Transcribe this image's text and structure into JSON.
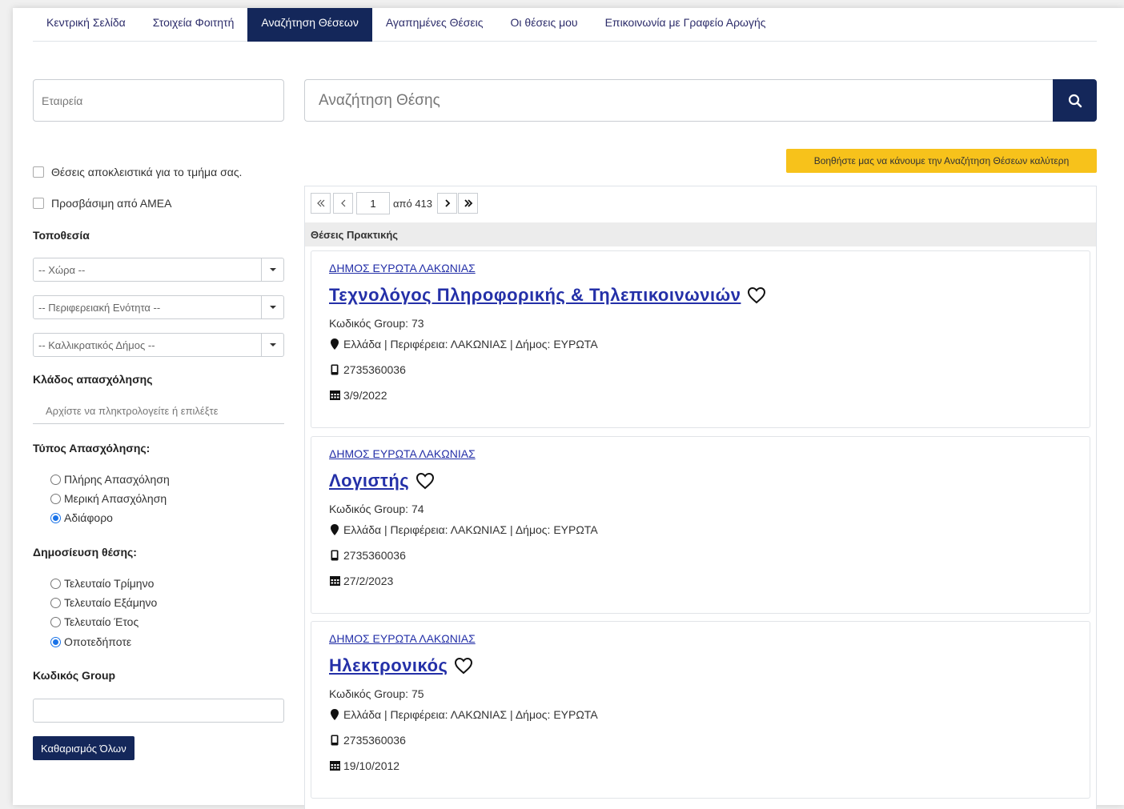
{
  "nav": {
    "items": [
      {
        "label": "Κεντρική Σελίδα"
      },
      {
        "label": "Στοιχεία Φοιτητή"
      },
      {
        "label": "Αναζήτηση Θέσεων"
      },
      {
        "label": "Αγαπημένες Θέσεις"
      },
      {
        "label": "Οι θέσεις μου"
      },
      {
        "label": "Επικοινωνία με Γραφείο Αρωγής"
      }
    ],
    "active_index": 2
  },
  "search": {
    "company_placeholder": "Εταιρεία",
    "job_placeholder": "Αναζήτηση Θέσης",
    "button_icon": "search-icon"
  },
  "filters": {
    "exclusive_label": "Θέσεις αποκλειστικά για το τμήμα σας.",
    "accessible_label": "Προσβάσιμη από ΑΜΕΑ",
    "location_title": "Τοποθεσία",
    "country_placeholder": "-- Χώρα --",
    "region_placeholder": "-- Περιφερειακή Ενότητα --",
    "municipality_placeholder": "-- Καλλικρατικός Δήμος --",
    "sector_title": "Κλάδος απασχόλησης",
    "sector_placeholder": "Αρχίστε να πληκτρολογείτε ή επιλέξτε",
    "employment_title": "Τύπος Απασχόλησης:",
    "employment_options": [
      "Πλήρης Απασχόληση",
      "Μερική Απασχόληση",
      "Αδιάφορο"
    ],
    "employment_selected": "Αδιάφορο",
    "published_title": "Δημοσίευση θέσης:",
    "published_options": [
      "Τελευταίο Τρίμηνο",
      "Τελευταίο Εξάμηνο",
      "Τελευταίο Έτος",
      "Οποτεδήποτε"
    ],
    "published_selected": "Οποτεδήποτε",
    "group_title": "Κωδικός Group",
    "group_value": "",
    "clear_label": "Καθαρισμός Όλων"
  },
  "help_label": "Βοηθήστε μας να κάνουμε την Αναζήτηση Θέσεων καλύτερη",
  "pager": {
    "first": "«",
    "prev": "‹",
    "current": "1",
    "of_label": "από 413",
    "next": "›",
    "last": "»"
  },
  "list_header": "Θέσεις Πρακτικής",
  "jobs": [
    {
      "company": "ΔΗΜΟΣ ΕΥΡΩΤΑ ΛΑΚΩΝΙΑΣ",
      "title": "Τεχνολόγος Πληροφορικής & Τηλεπικοινωνιών",
      "group": "Κωδικός Group: 73",
      "location": "Ελλάδα | Περιφέρεια: ΛΑΚΩΝΙΑΣ | Δήμος: ΕΥΡΩΤΑ",
      "phone": "2735360036",
      "date": "3/9/2022"
    },
    {
      "company": "ΔΗΜΟΣ ΕΥΡΩΤΑ ΛΑΚΩΝΙΑΣ",
      "title": "Λογιστής",
      "group": "Κωδικός Group: 74",
      "location": "Ελλάδα | Περιφέρεια: ΛΑΚΩΝΙΑΣ | Δήμος: ΕΥΡΩΤΑ",
      "phone": "2735360036",
      "date": "27/2/2023"
    },
    {
      "company": "ΔΗΜΟΣ ΕΥΡΩΤΑ ΛΑΚΩΝΙΑΣ",
      "title": "Ηλεκτρονικός",
      "group": "Κωδικός Group: 75",
      "location": "Ελλάδα | Περιφέρεια: ΛΑΚΩΝΙΑΣ | Δήμος: ΕΥΡΩΤΑ",
      "phone": "2735360036",
      "date": "19/10/2012"
    }
  ],
  "colors": {
    "primary": "#14275a",
    "link": "#2430a8",
    "help_bg": "#f7c21b"
  }
}
